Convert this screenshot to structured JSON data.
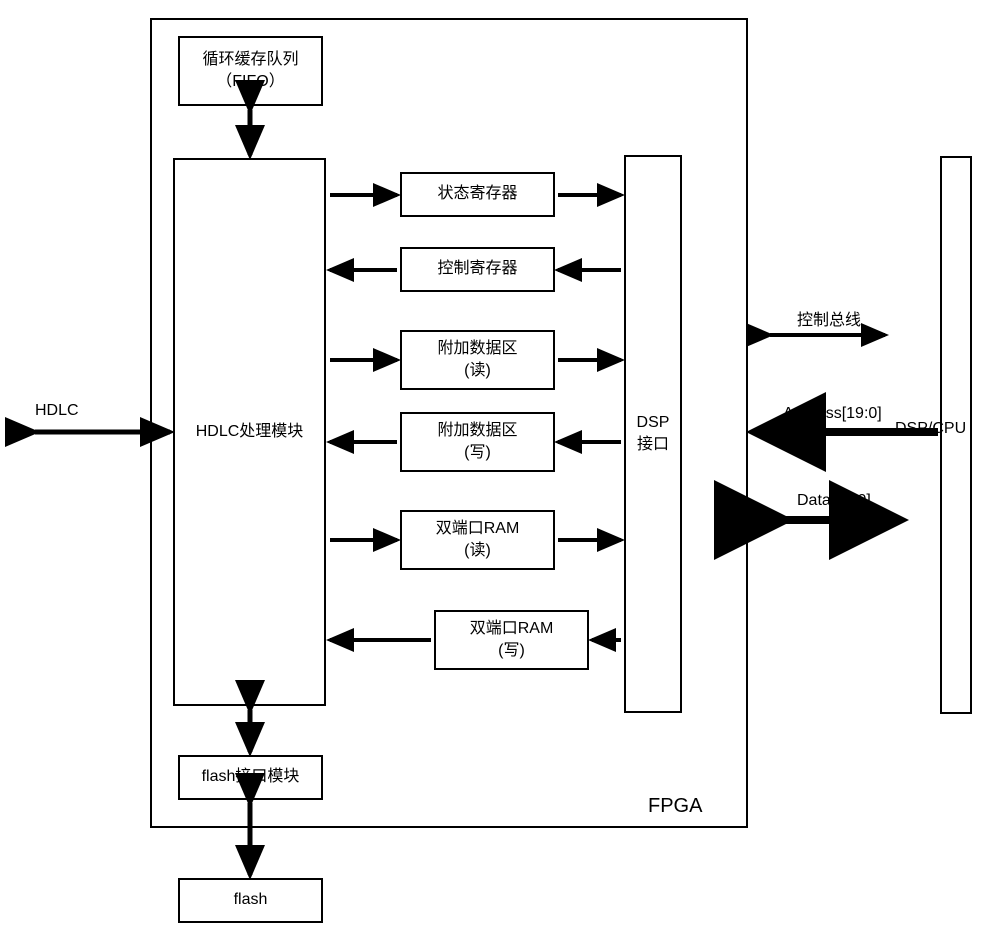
{
  "diagram": {
    "hdlc_left": "HDLC",
    "fifo": "循环缓存队列\n（FIFO）",
    "hdlc_module": "HDLC处理模块",
    "flash_interface": "flash接口模块",
    "flash": "flash",
    "status_reg": "状态寄存器",
    "control_reg": "控制寄存器",
    "extra_read_l1": "附加数据区",
    "extra_read_l2": "(读)",
    "extra_write_l1": "附加数据区",
    "extra_write_l2": "(写)",
    "dpram_read_l1": "双端口RAM",
    "dpram_read_l2": "(读)",
    "dpram_write_l1": "双端口RAM",
    "dpram_write_l2": "(写)",
    "dsp_interface_l1": "DSP",
    "dsp_interface_l2": "接口",
    "fpga_label": "FPGA",
    "bus_control": "控制总线",
    "bus_address": "Address[19:0]",
    "bus_data": "Data[15:0]",
    "dsp_cpu": "DSP/CPU"
  },
  "chart_data": {
    "type": "diagram",
    "container": "FPGA",
    "nodes": [
      {
        "id": "hdlc_ext",
        "label": "HDLC",
        "external": true
      },
      {
        "id": "fifo",
        "label": "循环缓存队列（FIFO）"
      },
      {
        "id": "hdlc_module",
        "label": "HDLC处理模块"
      },
      {
        "id": "flash_interface",
        "label": "flash接口模块"
      },
      {
        "id": "flash",
        "label": "flash",
        "external": true
      },
      {
        "id": "status_reg",
        "label": "状态寄存器"
      },
      {
        "id": "control_reg",
        "label": "控制寄存器"
      },
      {
        "id": "extra_read",
        "label": "附加数据区(读)"
      },
      {
        "id": "extra_write",
        "label": "附加数据区(写)"
      },
      {
        "id": "dpram_read",
        "label": "双端口RAM(读)"
      },
      {
        "id": "dpram_write",
        "label": "双端口RAM(写)"
      },
      {
        "id": "dsp_interface",
        "label": "DSP接口"
      },
      {
        "id": "dsp_cpu",
        "label": "DSP/CPU",
        "external": true
      }
    ],
    "edges": [
      {
        "from": "hdlc_ext",
        "to": "hdlc_module",
        "dir": "both"
      },
      {
        "from": "fifo",
        "to": "hdlc_module",
        "dir": "both"
      },
      {
        "from": "hdlc_module",
        "to": "status_reg",
        "dir": "forward"
      },
      {
        "from": "status_reg",
        "to": "dsp_interface",
        "dir": "forward"
      },
      {
        "from": "dsp_interface",
        "to": "control_reg",
        "dir": "forward"
      },
      {
        "from": "control_reg",
        "to": "hdlc_module",
        "dir": "forward"
      },
      {
        "from": "hdlc_module",
        "to": "extra_read",
        "dir": "forward"
      },
      {
        "from": "extra_read",
        "to": "dsp_interface",
        "dir": "forward"
      },
      {
        "from": "dsp_interface",
        "to": "extra_write",
        "dir": "forward"
      },
      {
        "from": "extra_write",
        "to": "hdlc_module",
        "dir": "forward"
      },
      {
        "from": "hdlc_module",
        "to": "dpram_read",
        "dir": "forward"
      },
      {
        "from": "dpram_read",
        "to": "dsp_interface",
        "dir": "forward"
      },
      {
        "from": "dsp_interface",
        "to": "dpram_write",
        "dir": "forward"
      },
      {
        "from": "dpram_write",
        "to": "hdlc_module",
        "dir": "forward"
      },
      {
        "from": "hdlc_module",
        "to": "flash_interface",
        "dir": "both"
      },
      {
        "from": "flash_interface",
        "to": "flash",
        "dir": "both"
      },
      {
        "from": "dsp_interface",
        "to": "dsp_cpu",
        "label": "控制总线",
        "dir": "both"
      },
      {
        "from": "dsp_cpu",
        "to": "dsp_interface",
        "label": "Address[19:0]",
        "dir": "forward"
      },
      {
        "from": "dsp_interface",
        "to": "dsp_cpu",
        "label": "Data[15:0]",
        "dir": "both"
      }
    ]
  }
}
